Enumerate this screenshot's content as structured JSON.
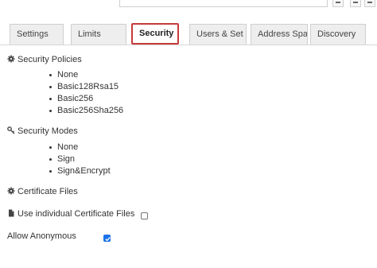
{
  "tabs": [
    {
      "label": "Settings",
      "active": false
    },
    {
      "label": "Limits",
      "active": false
    },
    {
      "label": "Security",
      "active": true
    },
    {
      "label": "Users & Set",
      "active": false
    },
    {
      "label": "Address Spa",
      "active": false
    },
    {
      "label": "Discovery",
      "active": false
    }
  ],
  "sections": {
    "policies": {
      "title": "Security Policies",
      "icon": "gear-icon",
      "items": [
        "None",
        "Basic128Rsa15",
        "Basic256",
        "Basic256Sha256"
      ]
    },
    "modes": {
      "title": "Security Modes",
      "icon": "key-icon",
      "items": [
        "None",
        "Sign",
        "Sign&Encrypt"
      ]
    },
    "certificates": {
      "title": "Certificate Files",
      "icon": "gear-icon"
    },
    "use_individual": {
      "label": "Use individual Certificate Files",
      "icon": "file-icon",
      "checked": false
    },
    "allow_anonymous": {
      "label": "Allow Anonymous",
      "checked": true
    }
  },
  "colors": {
    "active_tab_border": "#c73a3a",
    "checkbox_checked": "#1a73e8"
  }
}
